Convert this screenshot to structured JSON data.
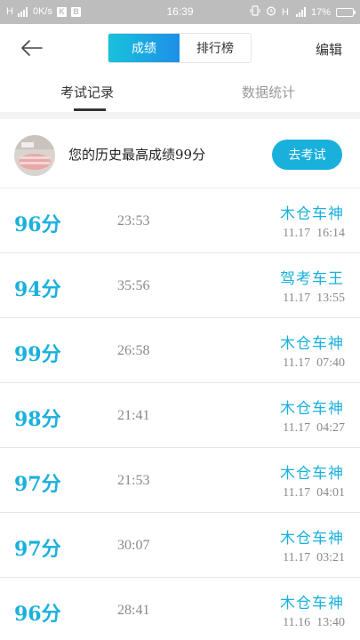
{
  "status_bar": {
    "network_type": "H",
    "speed": "0K/s",
    "time": "16:39",
    "network_type_right": "H",
    "battery": "17%"
  },
  "nav": {
    "tab_score": "成绩",
    "tab_ranking": "排行榜",
    "edit": "编辑"
  },
  "subtabs": {
    "exam_records": "考试记录",
    "data_stats": "数据统计"
  },
  "best": {
    "text": "您的历史最高成绩99分",
    "button": "去考试"
  },
  "records": [
    {
      "score": "96分",
      "duration": "23:53",
      "title": "木仓车神",
      "date": "11.17  16:14"
    },
    {
      "score": "94分",
      "duration": "35:56",
      "title": "驾考车王",
      "date": "11.17  13:55"
    },
    {
      "score": "99分",
      "duration": "26:58",
      "title": "木仓车神",
      "date": "11.17  07:40"
    },
    {
      "score": "98分",
      "duration": "21:41",
      "title": "木仓车神",
      "date": "11.17  04:27"
    },
    {
      "score": "97分",
      "duration": "21:53",
      "title": "木仓车神",
      "date": "11.17  04:01"
    },
    {
      "score": "97分",
      "duration": "30:07",
      "title": "木仓车神",
      "date": "11.17  03:21"
    },
    {
      "score": "96分",
      "duration": "28:41",
      "title": "木仓车神",
      "date": "11.16  13:40"
    }
  ],
  "colors": {
    "accent": "#1ab0dc",
    "status_bar": "#bdbdbd"
  }
}
